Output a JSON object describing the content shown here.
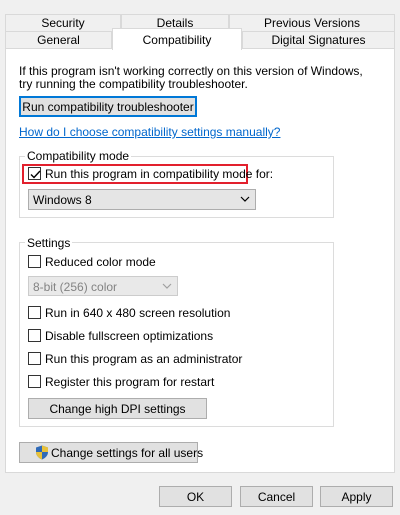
{
  "tabs": {
    "row1": [
      "Security",
      "Details",
      "Previous Versions"
    ],
    "row2": [
      "General",
      "Compatibility",
      "Digital Signatures"
    ],
    "active": "Compatibility"
  },
  "intro": {
    "line1": "If this program isn't working correctly on this version of Windows,",
    "line2": "try running the compatibility troubleshooter."
  },
  "troubleshooter_button": "Run compatibility troubleshooter",
  "manual_link": "How do I choose compatibility settings manually?",
  "compat_mode": {
    "title": "Compatibility mode",
    "checkbox_label": "Run this program in compatibility mode for:",
    "checked": true,
    "os_selected": "Windows 8"
  },
  "settings": {
    "title": "Settings",
    "reduced_color_label": "Reduced color mode",
    "reduced_color_checked": false,
    "color_selected": "8-bit (256) color",
    "options": [
      {
        "label": "Run in 640 x 480 screen resolution",
        "checked": false
      },
      {
        "label": "Disable fullscreen optimizations",
        "checked": false
      },
      {
        "label": "Run this program as an administrator",
        "checked": false
      },
      {
        "label": "Register this program for restart",
        "checked": false
      }
    ],
    "dpi_button": "Change high DPI settings"
  },
  "all_users_button": "Change settings for all users",
  "footer": {
    "ok": "OK",
    "cancel": "Cancel",
    "apply": "Apply"
  },
  "colors": {
    "accent": "#0078d7",
    "link": "#0066cc",
    "highlight": "#e2202d"
  }
}
